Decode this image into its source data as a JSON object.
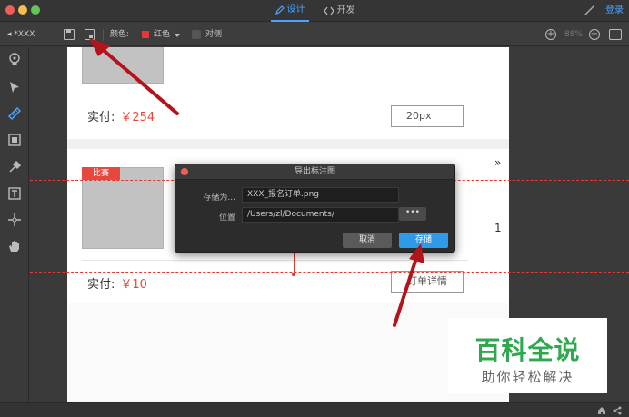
{
  "titlebar": {
    "tab_design": "设计",
    "tab_dev": "开发",
    "login": "登录"
  },
  "toolbar": {
    "doc_name": "*XXX",
    "color_label": "颜色:",
    "color_name": "红色",
    "color_value": "#e53935",
    "opposite_label": "对侧",
    "zoom": "88%"
  },
  "canvas": {
    "card1": {
      "pay_label": "实付:",
      "pay_amount": "￥254",
      "px_value": "20px"
    },
    "card2": {
      "badge": "比赛",
      "quote": "»",
      "side_mark": "1",
      "pay_label": "实付:",
      "pay_amount": "￥10",
      "detail_button": "订单详情"
    }
  },
  "dialog": {
    "title": "导出标注图",
    "save_as_label": "存储为...",
    "save_as_value": "XXX_报名订单.png",
    "location_label": "位置",
    "location_value": "/Users/zl/Documents/",
    "more_label": "•••",
    "cancel": "取消",
    "save": "存储"
  },
  "watermark": {
    "title": "百科全说",
    "subtitle": "助你轻松解决"
  },
  "colors": {
    "accent": "#2f9ae8",
    "price": "#e8473e",
    "arrow": "#b3131a"
  }
}
